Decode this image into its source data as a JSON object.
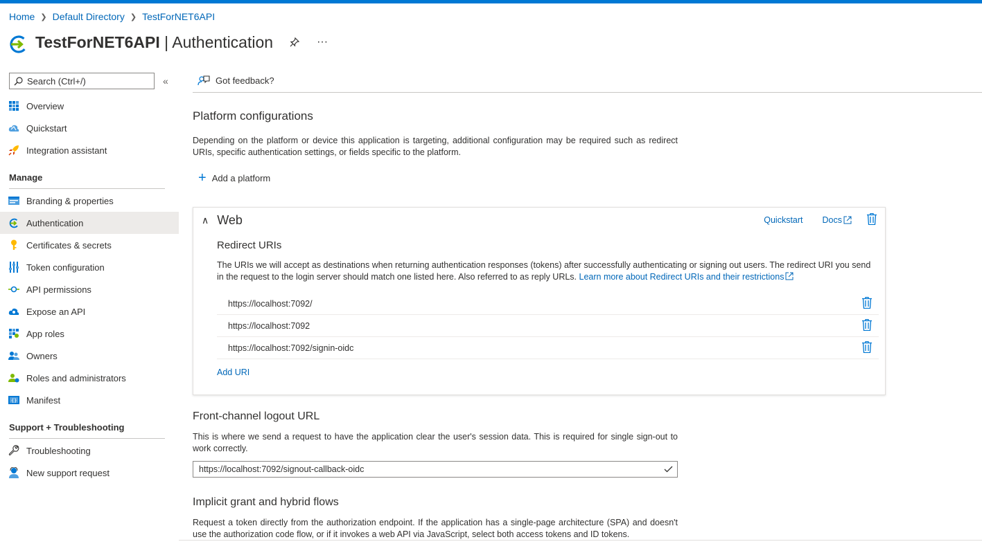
{
  "breadcrumb": {
    "items": [
      "Home",
      "Default Directory",
      "TestForNET6API"
    ]
  },
  "header": {
    "app_name": "TestForNET6API",
    "separator": " | ",
    "page_name": "Authentication",
    "pin_icon": "pin-icon",
    "more_icon": "more-icon",
    "more_label": "···"
  },
  "sidebar": {
    "search_placeholder": "Search (Ctrl+/)",
    "collapse_label": "«",
    "top_items": [
      {
        "label": "Overview",
        "icon": "overview-icon"
      },
      {
        "label": "Quickstart",
        "icon": "quickstart-icon"
      },
      {
        "label": "Integration assistant",
        "icon": "rocket-icon"
      }
    ],
    "manage_title": "Manage",
    "manage_items": [
      {
        "label": "Branding & properties",
        "icon": "branding-icon"
      },
      {
        "label": "Authentication",
        "icon": "authentication-icon",
        "active": true
      },
      {
        "label": "Certificates & secrets",
        "icon": "key-icon"
      },
      {
        "label": "Token configuration",
        "icon": "token-icon"
      },
      {
        "label": "API permissions",
        "icon": "api-permissions-icon"
      },
      {
        "label": "Expose an API",
        "icon": "cloud-icon"
      },
      {
        "label": "App roles",
        "icon": "app-roles-icon"
      },
      {
        "label": "Owners",
        "icon": "owners-icon"
      },
      {
        "label": "Roles and administrators",
        "icon": "roles-icon"
      },
      {
        "label": "Manifest",
        "icon": "manifest-icon"
      }
    ],
    "support_title": "Support + Troubleshooting",
    "support_items": [
      {
        "label": "Troubleshooting",
        "icon": "wrench-icon"
      },
      {
        "label": "New support request",
        "icon": "support-person-icon"
      }
    ]
  },
  "toolbar": {
    "feedback_label": "Got feedback?"
  },
  "platform": {
    "title": "Platform configurations",
    "description": "Depending on the platform or device this application is targeting, additional configuration may be required such as redirect URIs, specific authentication settings, or fields specific to the platform.",
    "add_label": "Add a platform"
  },
  "web_card": {
    "title": "Web",
    "quickstart_label": "Quickstart",
    "docs_label": "Docs",
    "redirect_title": "Redirect URIs",
    "redirect_desc": "The URIs we will accept as destinations when returning authentication responses (tokens) after successfully authenticating or signing out users. The redirect URI you send in the request to the login server should match one listed here. Also referred to as reply URLs. ",
    "learn_more_label": "Learn more about Redirect URIs and their restrictions",
    "uris": [
      "https://localhost:7092/",
      "https://localhost:7092",
      "https://localhost:7092/signin-oidc"
    ],
    "add_uri_label": "Add URI"
  },
  "logout": {
    "title": "Front-channel logout URL",
    "description": "This is where we send a request to have the application clear the user's session data. This is required for single sign-out to work correctly.",
    "value": "https://localhost:7092/signout-callback-oidc"
  },
  "implicit": {
    "title": "Implicit grant and hybrid flows",
    "description": "Request a token directly from the authorization endpoint. If the application has a single-page architecture (SPA) and doesn't use the authorization code flow, or if it invokes a web API via JavaScript, select both access tokens and ID tokens."
  },
  "colors": {
    "accent": "#0078d4",
    "link": "#0067b8",
    "active_bg": "#edebe9"
  }
}
